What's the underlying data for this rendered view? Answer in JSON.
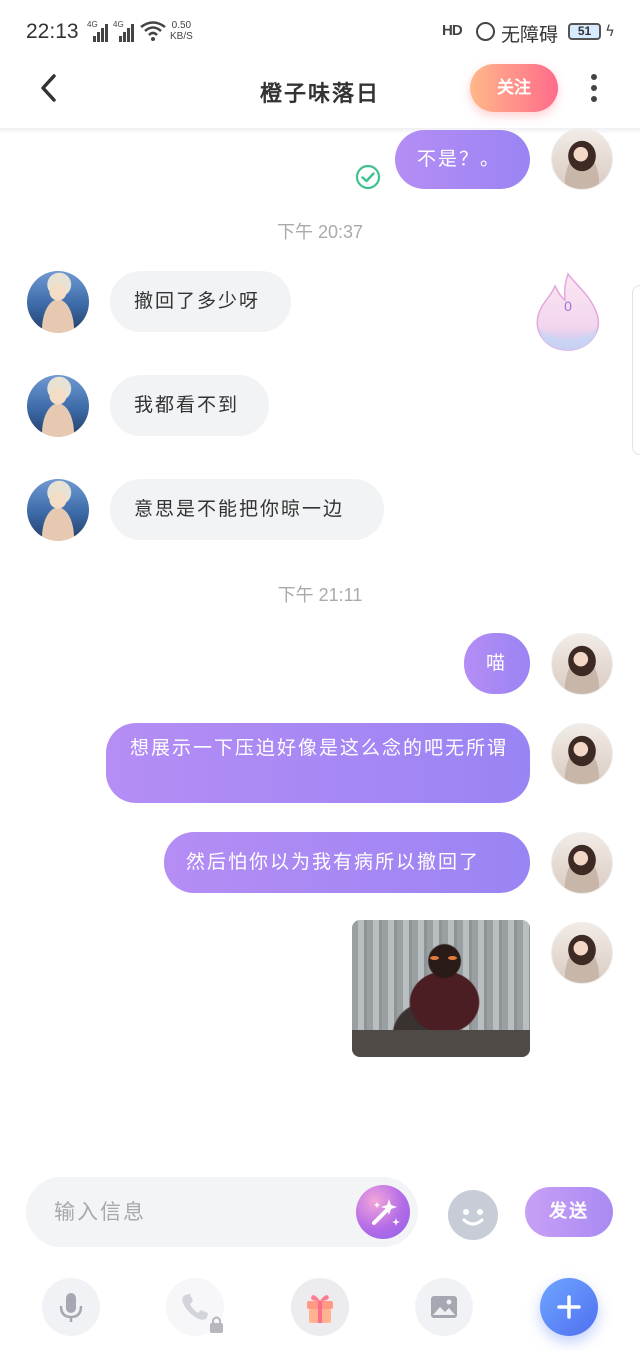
{
  "status_bar": {
    "time": "22:13",
    "network1": "4G",
    "network2": "4G",
    "speed_value": "0.50",
    "speed_unit": "KB/S",
    "hd_label": "HD",
    "accessibility_label": "无障碍",
    "battery_percent": "51"
  },
  "header": {
    "title": "橙子味落日",
    "follow_label": "关注"
  },
  "messages": [
    {
      "side": "out",
      "text": "不是？。"
    },
    {
      "side": "in",
      "text": "撤回了多少呀"
    },
    {
      "side": "in",
      "text": "我都看不到"
    },
    {
      "side": "in",
      "text": "意思是不能把你晾一边"
    },
    {
      "side": "out",
      "text": "喵"
    },
    {
      "side": "out",
      "text": "想展示一下压迫好像是这么念的吧无所谓"
    },
    {
      "side": "out",
      "text": "然后怕你以为我有病所以撤回了"
    }
  ],
  "timestamps": [
    "下午 20:37",
    "下午 21:11"
  ],
  "intimacy_count": "0",
  "composer": {
    "placeholder": "输入信息",
    "send_label": "发送"
  },
  "colors": {
    "accent_purple": "#a98af3",
    "follow_gradient_end": "#ff6b8a",
    "plus_blue": "#4f6ff0"
  },
  "icons": [
    "back-arrow-icon",
    "more-dots-icon",
    "read-check-icon",
    "flame-icon",
    "magic-wand-icon",
    "emoji-face-icon",
    "microphone-icon",
    "phone-icon",
    "lock-icon",
    "gift-icon",
    "image-icon",
    "plus-icon"
  ]
}
